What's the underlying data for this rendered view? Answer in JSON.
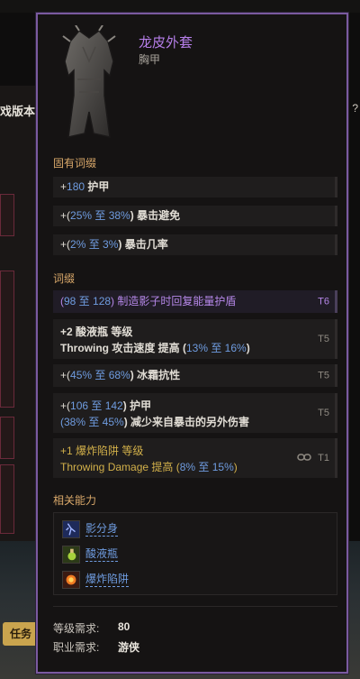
{
  "background": {
    "version_label": "戏版本:",
    "help_glyph": "?",
    "task_button": "任务"
  },
  "item": {
    "name": "龙皮外套",
    "type": "胸甲"
  },
  "implicit": {
    "title": "固有词缀",
    "rows": [
      {
        "a": "+",
        "b": "180",
        "c": " 护甲"
      },
      {
        "a": "+(",
        "b": "25% 至 38%",
        "c": ") 暴击避免"
      },
      {
        "a": "+(",
        "b": "2% 至 3%",
        "c": ") 暴击几率"
      }
    ]
  },
  "affixes": {
    "title": "词缀",
    "r1": {
      "a": "(",
      "b": "98 至 128",
      "c": ") 制造影子时回复能量护盾",
      "tier": "T6"
    },
    "r2": {
      "l1a": "+2",
      "l1b": " 酸液瓶 等级",
      "l2a": "Throwing 攻击速度 提高 (",
      "l2b": "13% 至 16%",
      "l2c": ")",
      "tier": "T5"
    },
    "r3": {
      "a": "+(",
      "b": "45% 至 68%",
      "c": ") 冰霜抗性",
      "tier": "T5"
    },
    "r4": {
      "l1a": "+(",
      "l1b": "106 至 142",
      "l1c": ") 护甲",
      "l2a": "(",
      "l2b": "38% 至 45%",
      "l2c": ") 减少来自暴击的另外伤害",
      "tier": "T5"
    },
    "r5": {
      "l1a": "+1",
      "l1b": " 爆炸陷阱 等级",
      "l2a": "Throwing Damage 提高 (",
      "l2b": "8% 至 15%",
      "l2c": ")",
      "link_icon": "link-icon",
      "tier": "T1"
    }
  },
  "related": {
    "title": "相关能力",
    "items": [
      {
        "label": "影分身",
        "icon": "shadow-clone-icon"
      },
      {
        "label": "酸液瓶",
        "icon": "acid-flask-icon"
      },
      {
        "label": "爆炸陷阱",
        "icon": "explosive-trap-icon"
      }
    ]
  },
  "requirements": {
    "level_label": "等级需求:",
    "level_value": "80",
    "class_label": "职业需求:",
    "class_value": "游侠"
  },
  "colors": {
    "border": "#7a5aa0",
    "item_name": "#b57ee8",
    "section_title": "#d9a86a",
    "value_blue": "#6f9ce0",
    "gold_affix": "#d2b04a"
  }
}
